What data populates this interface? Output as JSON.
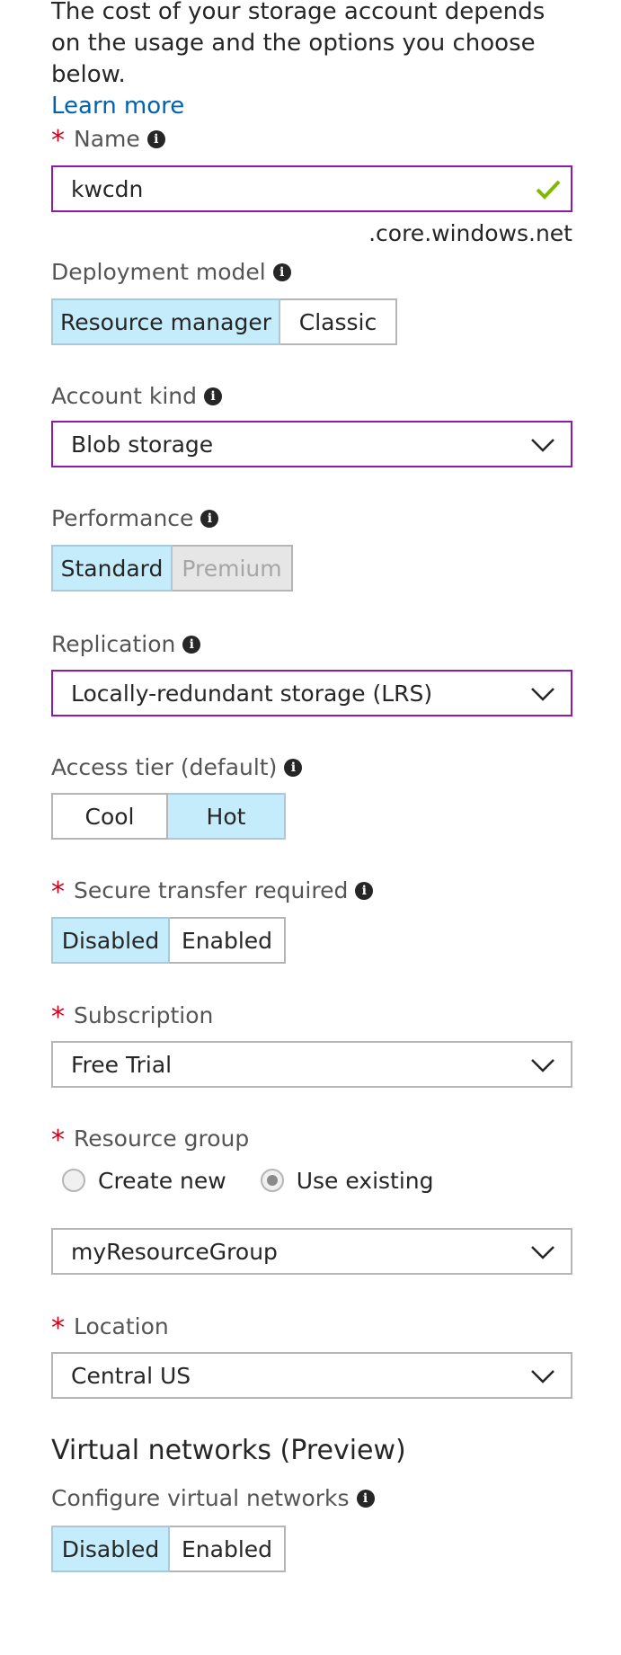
{
  "intro": {
    "text": "The cost of your storage account depends on the usage and the options you choose below.",
    "link": "Learn more"
  },
  "name": {
    "label": "Name",
    "value": "kwcdn",
    "suffix": ".core.windows.net"
  },
  "deployment_model": {
    "label": "Deployment model",
    "options": [
      "Resource manager",
      "Classic"
    ],
    "selected": "Resource manager"
  },
  "account_kind": {
    "label": "Account kind",
    "value": "Blob storage"
  },
  "performance": {
    "label": "Performance",
    "options": [
      "Standard",
      "Premium"
    ],
    "selected": "Standard"
  },
  "replication": {
    "label": "Replication",
    "value": "Locally-redundant storage (LRS)"
  },
  "access_tier": {
    "label": "Access tier (default)",
    "options": [
      "Cool",
      "Hot"
    ],
    "selected": "Hot"
  },
  "secure_transfer": {
    "label": "Secure transfer required",
    "options": [
      "Disabled",
      "Enabled"
    ],
    "selected": "Disabled"
  },
  "subscription": {
    "label": "Subscription",
    "value": "Free Trial"
  },
  "resource_group": {
    "label": "Resource group",
    "radio_options": [
      "Create new",
      "Use existing"
    ],
    "radio_selected": "Use existing",
    "value": "myResourceGroup"
  },
  "location": {
    "label": "Location",
    "value": "Central US"
  },
  "virtual_networks": {
    "title": "Virtual networks (Preview)",
    "label": "Configure virtual networks",
    "options": [
      "Disabled",
      "Enabled"
    ],
    "selected": "Disabled"
  },
  "colors": {
    "accent_border": "#8b1ba8",
    "selected_fill": "#c4ecfb",
    "required": "#d0021b",
    "link": "#0063b1",
    "valid_check": "#7fba00"
  },
  "icons": {
    "info": "info-icon",
    "dropdown": "chevron-down-icon",
    "valid": "checkmark-icon"
  }
}
